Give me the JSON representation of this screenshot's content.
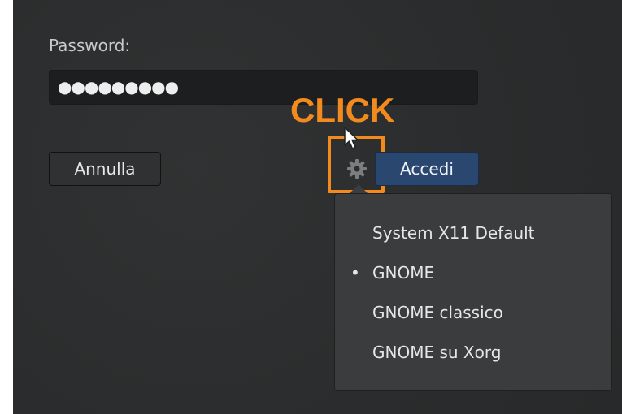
{
  "login": {
    "password_label": "Password:",
    "password_value": "●●●●●●●●●",
    "cancel_label": "Annulla",
    "login_label": "Accedi",
    "settings_icon": "gear-icon"
  },
  "annotation": {
    "click_text": "CLICK",
    "color": "#f28a1e"
  },
  "session_menu": {
    "items": [
      {
        "label": "System X11 Default",
        "selected": false,
        "marker": ""
      },
      {
        "label": "GNOME",
        "selected": true,
        "marker": "•"
      },
      {
        "label": "GNOME classico",
        "selected": false,
        "marker": ""
      },
      {
        "label": "GNOME su Xorg",
        "selected": false,
        "marker": ""
      }
    ]
  },
  "colors": {
    "background": "#2b2d2e",
    "accent_button": "#2a4770",
    "highlight": "#f28a1e"
  }
}
